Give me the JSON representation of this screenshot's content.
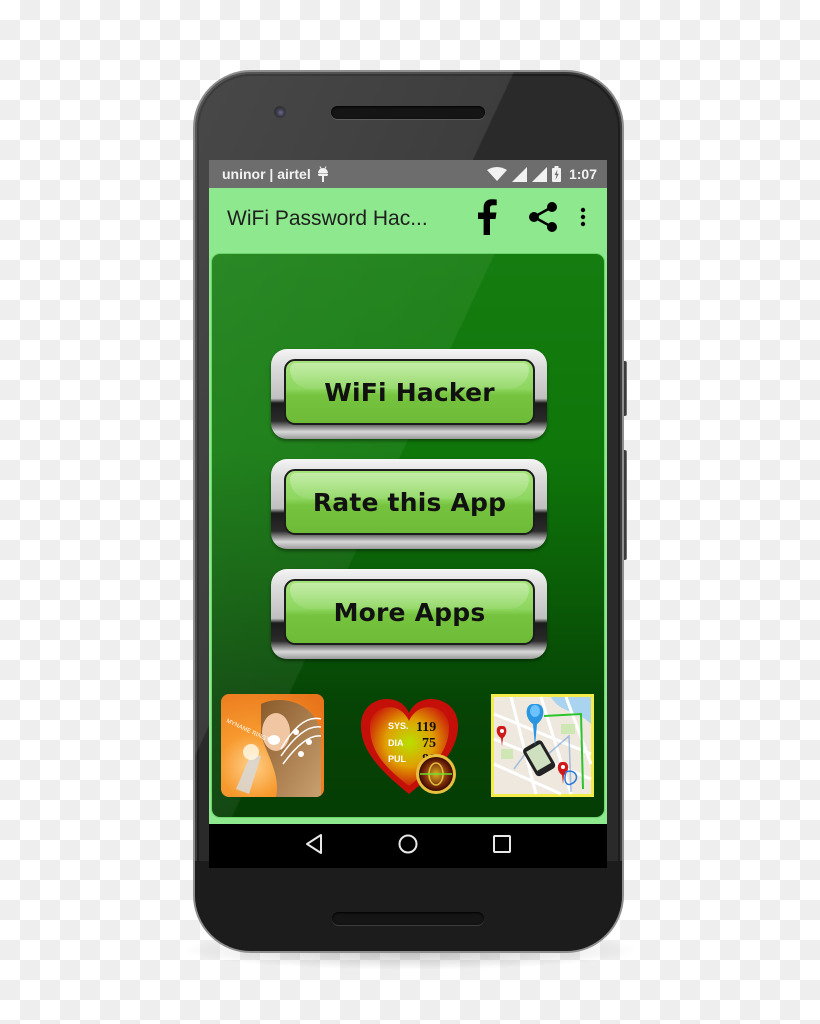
{
  "status_bar": {
    "carrier": "uninor | airtel",
    "notification_icon": "android-debug-icon",
    "icons": [
      "wifi-icon",
      "signal-icon",
      "signal-icon",
      "battery-charging-icon"
    ],
    "time": "1:07"
  },
  "app_bar": {
    "title": "WiFi Password Hac...",
    "background_color": "#8ee88e",
    "actions": [
      {
        "name": "facebook",
        "icon": "facebook-icon"
      },
      {
        "name": "share",
        "icon": "share-icon"
      },
      {
        "name": "overflow-menu",
        "icon": "more-vert-icon"
      }
    ]
  },
  "main": {
    "card_color": "#0f770a",
    "buttons": [
      {
        "label": "WiFi Hacker"
      },
      {
        "label": "Rate this App"
      },
      {
        "label": "More Apps"
      }
    ],
    "promo_apps": [
      {
        "icon": "name-ringtone-app-icon"
      },
      {
        "icon": "blood-pressure-app-icon",
        "readings": {
          "sys_label": "SYS.",
          "sys": "119",
          "dia_label": "DIA",
          "dia": "75",
          "pul_label": "PUL",
          "pul": "80"
        }
      },
      {
        "icon": "mobile-locator-map-icon"
      }
    ]
  },
  "nav_bar": {
    "buttons": [
      "back-icon",
      "home-icon",
      "recents-icon"
    ]
  }
}
